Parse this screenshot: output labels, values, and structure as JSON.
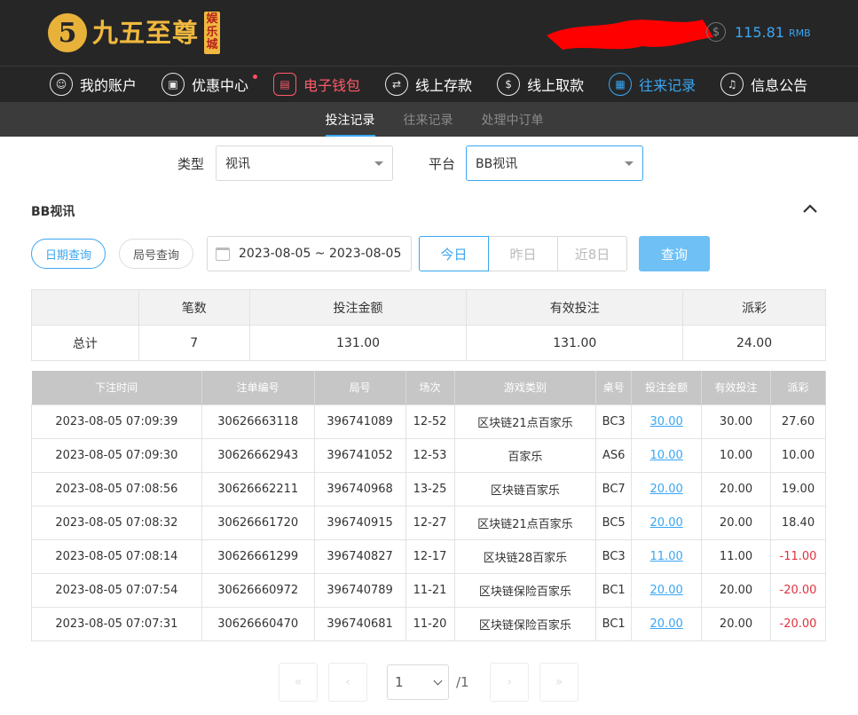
{
  "header": {
    "logo_digit": "5",
    "logo_text": "九五至尊",
    "logo_badge": [
      "娱",
      "乐",
      "城"
    ],
    "balance": "115.81",
    "currency": "RMB",
    "coin_glyph": "$"
  },
  "nav": {
    "items": [
      {
        "label": "我的账户",
        "icon": "user-icon",
        "glyph": "☺"
      },
      {
        "label": "优惠中心",
        "icon": "gift-icon",
        "glyph": "▣"
      },
      {
        "label": "电子钱包",
        "icon": "wallet-icon",
        "glyph": "▤"
      },
      {
        "label": "线上存款",
        "icon": "deposit-icon",
        "glyph": "⇄"
      },
      {
        "label": "线上取款",
        "icon": "withdraw-icon",
        "glyph": "$"
      },
      {
        "label": "往来记录",
        "icon": "records-icon",
        "glyph": "▦"
      },
      {
        "label": "信息公告",
        "icon": "bell-icon",
        "glyph": "♫"
      }
    ]
  },
  "subnav": {
    "tabs": [
      "投注记录",
      "往来记录",
      "处理中订单"
    ]
  },
  "filters": {
    "type_label": "类型",
    "type_value": "视讯",
    "platform_label": "平台",
    "platform_value": "BB视讯"
  },
  "section": {
    "title": "BB视讯"
  },
  "query": {
    "date_query": "日期查询",
    "round_query": "局号查询",
    "date_range": "2023-08-05 ~ 2023-08-05",
    "today": "今日",
    "yesterday": "昨日",
    "last8": "近8日",
    "search": "查询"
  },
  "summary": {
    "headers": [
      "",
      "笔数",
      "投注金额",
      "有效投注",
      "派彩"
    ],
    "row": [
      "总计",
      "7",
      "131.00",
      "131.00",
      "24.00"
    ]
  },
  "records": {
    "headers": [
      "下注时间",
      "注单编号",
      "局号",
      "场次",
      "游戏类别",
      "桌号",
      "投注金额",
      "有效投注",
      "派彩"
    ],
    "rows": [
      [
        "2023-08-05 07:09:39",
        "30626663118",
        "396741089",
        "12-52",
        "区块链21点百家乐",
        "BC3",
        "30.00",
        "30.00",
        "27.60"
      ],
      [
        "2023-08-05 07:09:30",
        "30626662943",
        "396741052",
        "12-53",
        "百家乐",
        "AS6",
        "10.00",
        "10.00",
        "10.00"
      ],
      [
        "2023-08-05 07:08:56",
        "30626662211",
        "396740968",
        "13-25",
        "区块链百家乐",
        "BC7",
        "20.00",
        "20.00",
        "19.00"
      ],
      [
        "2023-08-05 07:08:32",
        "30626661720",
        "396740915",
        "12-27",
        "区块链21点百家乐",
        "BC5",
        "20.00",
        "20.00",
        "18.40"
      ],
      [
        "2023-08-05 07:08:14",
        "30626661299",
        "396740827",
        "12-17",
        "区块链28百家乐",
        "BC3",
        "11.00",
        "11.00",
        "-11.00"
      ],
      [
        "2023-08-05 07:07:54",
        "30626660972",
        "396740789",
        "11-21",
        "区块链保险百家乐",
        "BC1",
        "20.00",
        "20.00",
        "-20.00"
      ],
      [
        "2023-08-05 07:07:31",
        "30626660470",
        "396740681",
        "11-20",
        "区块链保险百家乐",
        "BC1",
        "20.00",
        "20.00",
        "-20.00"
      ]
    ]
  },
  "pagination": {
    "first": "«",
    "prev": "‹",
    "page": "1",
    "total": "/1",
    "next": "›",
    "last": "»"
  },
  "colors": {
    "accent": "#3aa6f2",
    "wallet": "#ff5a6a",
    "negative": "#e0323d",
    "gold": "#f0b83e",
    "redaction": "#ff0000"
  }
}
